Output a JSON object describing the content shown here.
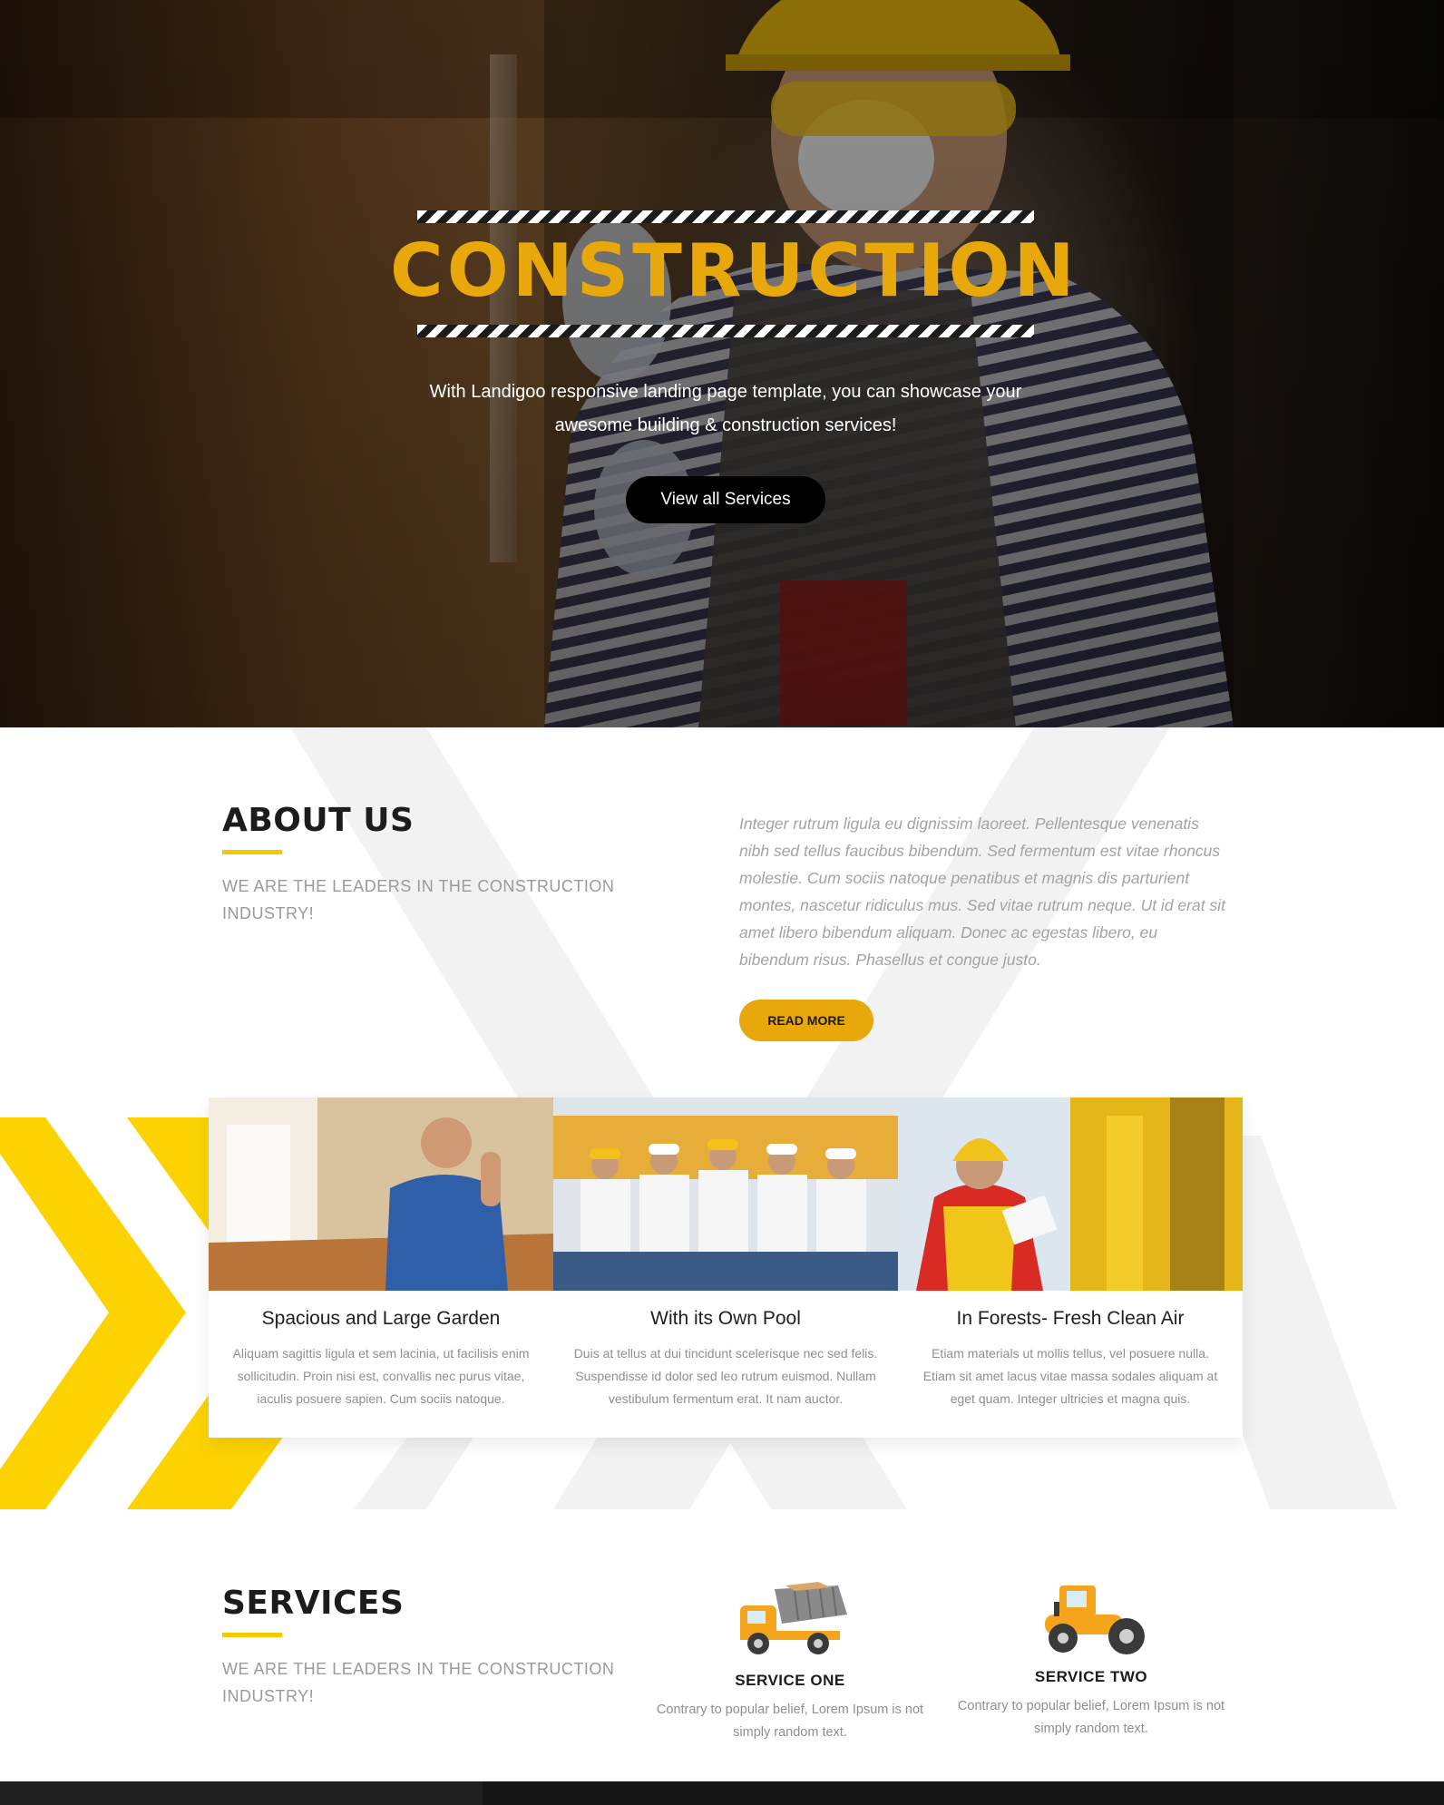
{
  "hero": {
    "title": "CONSTRUCTION",
    "subtitle_line1": "With Landigoo responsive landing page template, you can showcase your",
    "subtitle_line2": "awesome building & construction services!",
    "button_label": "View all Services"
  },
  "about": {
    "title": "ABOUT US",
    "tagline_line1": "WE ARE THE LEADERS IN THE CONSTRUCTION",
    "tagline_line2": "INDUSTRY!",
    "paragraph": "Integer rutrum ligula eu dignissim laoreet. Pellentesque venenatis nibh sed tellus faucibus bibendum. Sed fermentum est vitae rhoncus molestie. Cum sociis natoque penatibus et magnis dis parturient montes, nascetur ridiculus mus. Sed vitae rutrum neque. Ut id erat sit amet libero bibendum aliquam. Donec ac egestas libero, eu bibendum risus. Phasellus et congue justo.",
    "button_label": "READ MORE"
  },
  "cards": [
    {
      "title": "Spacious and Large Garden",
      "text": "Aliquam sagittis ligula et sem lacinia, ut facilisis enim sollicitudin. Proin nisi est, convallis nec purus vitae, iaculis posuere sapien. Cum sociis natoque."
    },
    {
      "title": "With its Own Pool",
      "text": "Duis at tellus at dui tincidunt scelerisque nec sed felis. Suspendisse id dolor sed leo rutrum euismod. Nullam vestibulum fermentum erat. It nam auctor."
    },
    {
      "title": "In Forests- Fresh Clean Air",
      "text": "Etiam materials ut mollis tellus, vel posuere nulla. Etiam sit amet lacus vitae massa sodales aliquam at eget quam. Integer ultricies et magna quis."
    }
  ],
  "services": {
    "title": "SERVICES",
    "tagline_line1": "WE ARE THE LEADERS IN THE CONSTRUCTION",
    "tagline_line2": "INDUSTRY!",
    "items": [
      {
        "title": "SERVICE ONE",
        "text": "Contrary to popular belief, Lorem Ipsum is not simply random text.",
        "icon": "dump-truck-icon"
      },
      {
        "title": "SERVICE TWO",
        "text": "Contrary to popular belief, Lorem Ipsum is not simply random text.",
        "icon": "road-roller-icon"
      }
    ]
  },
  "colors": {
    "accent": "#e8a80c",
    "chevron_yellow": "#fcd300",
    "watermark_gray": "#f2f2f2"
  }
}
